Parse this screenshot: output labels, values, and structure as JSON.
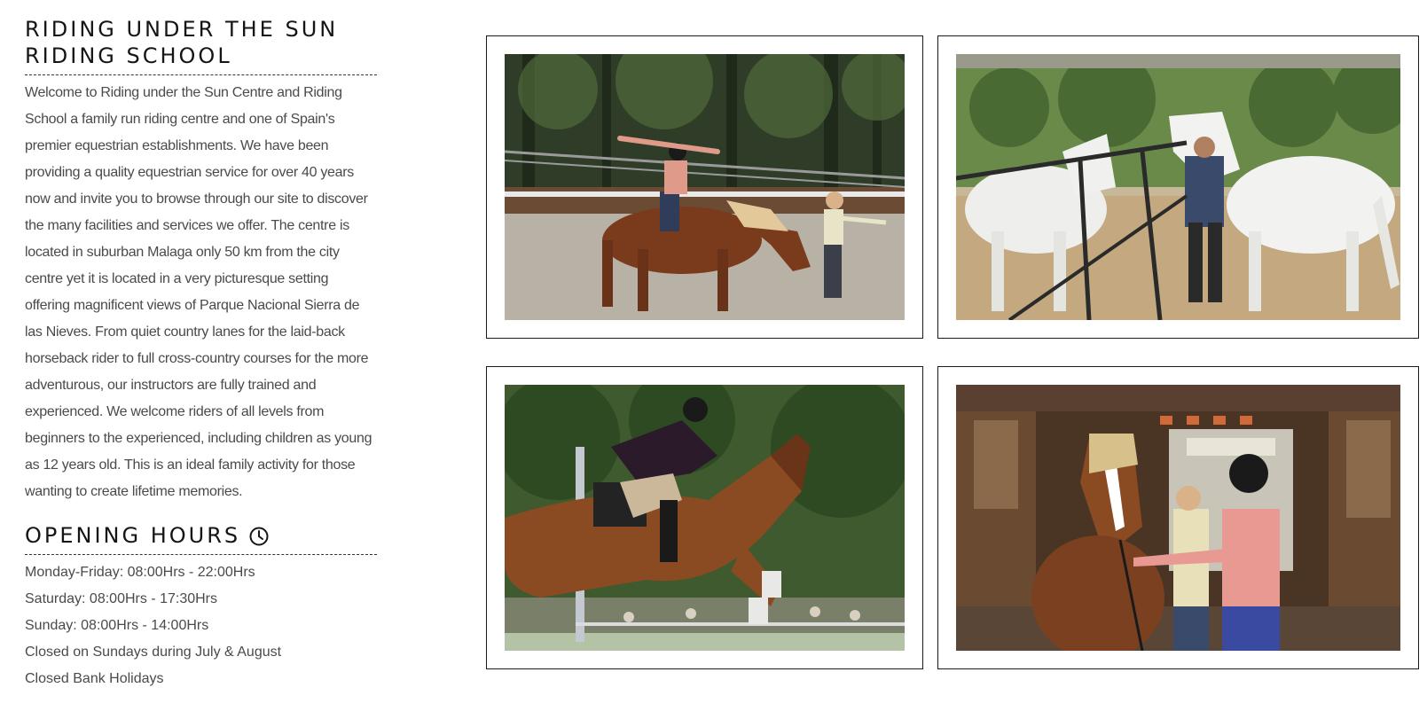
{
  "intro": {
    "title_line1": "RIDING UNDER THE SUN",
    "title_line2": "RIDING SCHOOL",
    "body": "Welcome to Riding under the Sun Centre and Riding School a family run riding centre and one of Spain's premier equestrian establishments. We have been providing a quality equestrian service for over 40 years now and invite you to browse through our site to discover the many facilities and services we offer. The centre is located in suburban Malaga only 50 km from the city centre yet it is located in a very picturesque setting offering magnificent views of Parque Nacional Sierra de las Nieves. From quiet country lanes for the laid-back horseback rider to full cross-country courses for the more adventurous, our instructors are fully trained and experienced. We welcome riders of all levels from beginners to the experienced, including children as young as 12 years old. This is an ideal family activity for those wanting to create lifetime memories."
  },
  "hours": {
    "title": "OPENING HOURS",
    "icon": "clock-icon",
    "items": [
      "Monday-Friday: 08:00Hrs - 22:00Hrs",
      "Saturday: 08:00Hrs - 17:30Hrs",
      "Sunday: 08:00Hrs - 14:00Hrs",
      "Closed on Sundays during July & August",
      "Closed Bank Holidays"
    ]
  },
  "gallery": {
    "photos": [
      {
        "icon": "photo-rider-arms-outstretched"
      },
      {
        "icon": "photo-grooming-white-horses"
      },
      {
        "icon": "photo-show-jumping"
      },
      {
        "icon": "photo-stable-horse"
      }
    ]
  },
  "colors": {
    "text": "#4a4a4a",
    "heading": "#151515",
    "frame_border": "#1a1a1a",
    "background": "#ffffff"
  }
}
